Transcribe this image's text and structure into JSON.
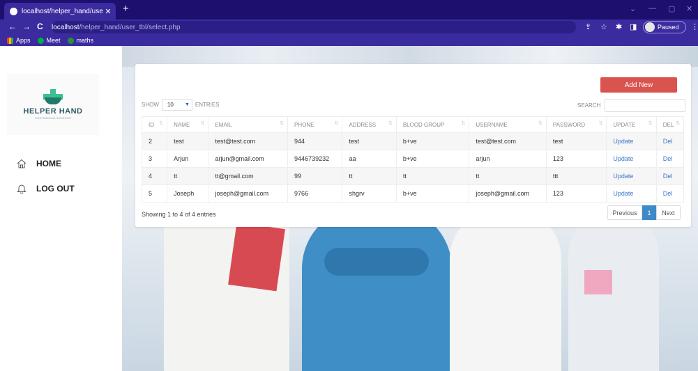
{
  "browser": {
    "tab_title": "localhost/helper_hand/user_tbl/",
    "url_host": "localhost",
    "url_path": "/helper_hand/user_tbl/select.php",
    "profile_label": "Paused",
    "bookmarks": [
      "Apps",
      "Meet",
      "maths"
    ]
  },
  "sidebar": {
    "logo_text": "HELPER HAND",
    "logo_tagline": "YOUR MEDICAL ASSISTANT",
    "items": [
      {
        "label": "HOME",
        "icon": "home-icon"
      },
      {
        "label": "LOG OUT",
        "icon": "bell-icon"
      }
    ]
  },
  "table_controls": {
    "add_new_label": "Add New",
    "show_label": "SHOW",
    "entries_value": "10",
    "entries_label": "ENTRIES",
    "search_label": "SEARCH"
  },
  "table": {
    "columns": [
      "ID",
      "NAME",
      "EMAIL",
      "PHONE",
      "ADDRESS",
      "BLOOD GROUP",
      "USERNAME",
      "PASSWORD",
      "UPDATE",
      "DEL"
    ],
    "rows": [
      [
        "2",
        "test",
        "test@test.com",
        "944",
        "test",
        "b+ve",
        "test@test.com",
        "test",
        "Update",
        "Del"
      ],
      [
        "3",
        "Arjun",
        "arjun@gmail.com",
        "9446739232",
        "aa",
        "b+ve",
        "arjun",
        "123",
        "Update",
        "Del"
      ],
      [
        "4",
        "tt",
        "tt@gmail.com",
        "99",
        "tt",
        "tt",
        "tt",
        "ttt",
        "Update",
        "Del"
      ],
      [
        "5",
        "Joseph",
        "joseph@gmail.com",
        "9766",
        "shgrv",
        "b+ve",
        "joseph@gmail.com",
        "123",
        "Update",
        "Del"
      ]
    ]
  },
  "footer": {
    "info": "Showing 1 to 4 of 4 entries",
    "previous_label": "Previous",
    "current_page": "1",
    "next_label": "Next"
  }
}
